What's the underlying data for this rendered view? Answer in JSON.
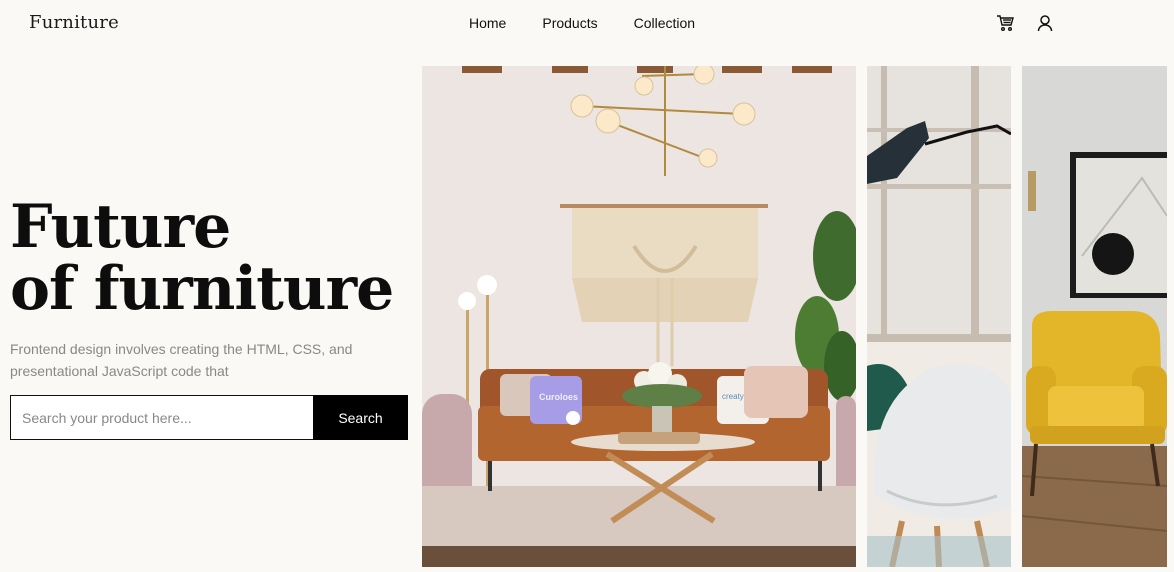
{
  "header": {
    "logo": "Furniture",
    "nav": [
      "Home",
      "Products",
      "Collection"
    ],
    "icons": [
      "cart-icon",
      "user-icon"
    ]
  },
  "hero": {
    "title_line1": "Future",
    "title_line2": "of furniture",
    "description": "Frontend design involves creating the HTML, CSS, and presentational JavaScript code that",
    "search": {
      "placeholder": "Search your product here...",
      "button_label": "Search"
    }
  },
  "gallery": {
    "images": [
      "living-room-sofa-image",
      "white-chair-lamp-image",
      "yellow-armchair-image"
    ],
    "pillow_texts": [
      "Curoloes",
      "creatyoskin"
    ]
  },
  "colors": {
    "background": "#faf9f6",
    "button": "#000000",
    "sofa": "#a0562a",
    "armchair": "#e3b62a"
  }
}
